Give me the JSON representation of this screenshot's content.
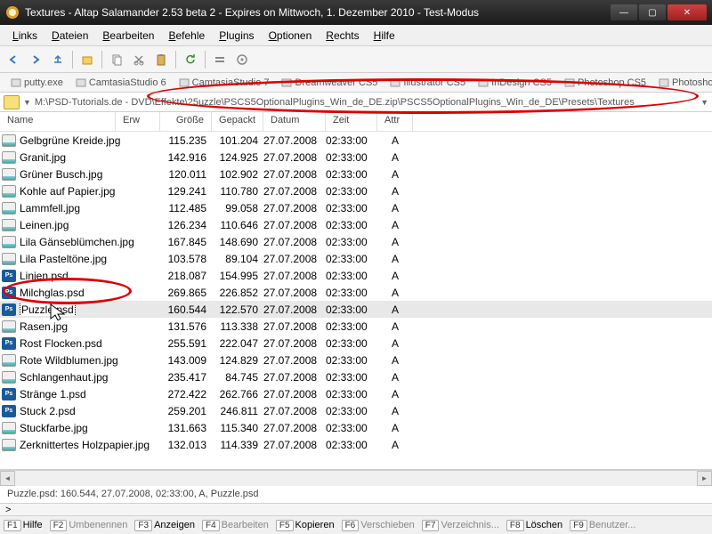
{
  "title": "Textures - Altap Salamander 2.53 beta 2 - Expires on Mittwoch, 1. Dezember 2010 - Test-Modus",
  "menu": [
    "Links",
    "Dateien",
    "Bearbeiten",
    "Befehle",
    "Plugins",
    "Optionen",
    "Rechts",
    "Hilfe"
  ],
  "tabs": [
    "putty.exe",
    "CamtasiaStudio 6",
    "CamtasiaStudio 7",
    "Dreamweaver CS5",
    "Illustrator CS5",
    "InDesign CS5",
    "Photoshop CS5",
    "Photoshop"
  ],
  "path_left": "M:\\PSD-Tutorials.de - DVD\\Effekte\\25",
  "path_right": "uzzle\\PSCS5OptionalPlugins_Win_de_DE.zip\\PSCS5OptionalPlugins_Win_de_DE\\Presets\\Textures",
  "cols": {
    "name": "Name",
    "erw": "Erw",
    "size": "Größe",
    "packed": "Gepackt",
    "date": "Datum",
    "time": "Zeit",
    "attr": "Attr"
  },
  "selected": "Puzzle.psd",
  "files": [
    {
      "n": "Gelbgrüne Kreide.jpg",
      "t": "jpg",
      "s": "115.235",
      "p": "101.204",
      "d": "27.07.2008",
      "tm": "02:33:00",
      "a": "A"
    },
    {
      "n": "Granit.jpg",
      "t": "jpg",
      "s": "142.916",
      "p": "124.925",
      "d": "27.07.2008",
      "tm": "02:33:00",
      "a": "A"
    },
    {
      "n": "Grüner Busch.jpg",
      "t": "jpg",
      "s": "120.011",
      "p": "102.902",
      "d": "27.07.2008",
      "tm": "02:33:00",
      "a": "A"
    },
    {
      "n": "Kohle auf Papier.jpg",
      "t": "jpg",
      "s": "129.241",
      "p": "110.780",
      "d": "27.07.2008",
      "tm": "02:33:00",
      "a": "A"
    },
    {
      "n": "Lammfell.jpg",
      "t": "jpg",
      "s": "112.485",
      "p": "99.058",
      "d": "27.07.2008",
      "tm": "02:33:00",
      "a": "A"
    },
    {
      "n": "Leinen.jpg",
      "t": "jpg",
      "s": "126.234",
      "p": "110.646",
      "d": "27.07.2008",
      "tm": "02:33:00",
      "a": "A"
    },
    {
      "n": "Lila Gänseblümchen.jpg",
      "t": "jpg",
      "s": "167.845",
      "p": "148.690",
      "d": "27.07.2008",
      "tm": "02:33:00",
      "a": "A"
    },
    {
      "n": "Lila Pasteltöne.jpg",
      "t": "jpg",
      "s": "103.578",
      "p": "89.104",
      "d": "27.07.2008",
      "tm": "02:33:00",
      "a": "A"
    },
    {
      "n": "Linien.psd",
      "t": "psd",
      "s": "218.087",
      "p": "154.995",
      "d": "27.07.2008",
      "tm": "02:33:00",
      "a": "A"
    },
    {
      "n": "Milchglas.psd",
      "t": "psd",
      "s": "269.865",
      "p": "226.852",
      "d": "27.07.2008",
      "tm": "02:33:00",
      "a": "A"
    },
    {
      "n": "Puzzle.psd",
      "t": "psd",
      "s": "160.544",
      "p": "122.570",
      "d": "27.07.2008",
      "tm": "02:33:00",
      "a": "A"
    },
    {
      "n": "Rasen.jpg",
      "t": "jpg",
      "s": "131.576",
      "p": "113.338",
      "d": "27.07.2008",
      "tm": "02:33:00",
      "a": "A"
    },
    {
      "n": "Rost Flocken.psd",
      "t": "psd",
      "s": "255.591",
      "p": "222.047",
      "d": "27.07.2008",
      "tm": "02:33:00",
      "a": "A"
    },
    {
      "n": "Rote Wildblumen.jpg",
      "t": "jpg",
      "s": "143.009",
      "p": "124.829",
      "d": "27.07.2008",
      "tm": "02:33:00",
      "a": "A"
    },
    {
      "n": "Schlangenhaut.jpg",
      "t": "jpg",
      "s": "235.417",
      "p": "84.745",
      "d": "27.07.2008",
      "tm": "02:33:00",
      "a": "A"
    },
    {
      "n": "Stränge 1.psd",
      "t": "psd",
      "s": "272.422",
      "p": "262.766",
      "d": "27.07.2008",
      "tm": "02:33:00",
      "a": "A"
    },
    {
      "n": "Stuck 2.psd",
      "t": "psd",
      "s": "259.201",
      "p": "246.811",
      "d": "27.07.2008",
      "tm": "02:33:00",
      "a": "A"
    },
    {
      "n": "Stuckfarbe.jpg",
      "t": "jpg",
      "s": "131.663",
      "p": "115.340",
      "d": "27.07.2008",
      "tm": "02:33:00",
      "a": "A"
    },
    {
      "n": "Zerknittertes Holzpapier.jpg",
      "t": "jpg",
      "s": "132.013",
      "p": "114.339",
      "d": "27.07.2008",
      "tm": "02:33:00",
      "a": "A"
    }
  ],
  "status": "Puzzle.psd: 160.544, 27.07.2008, 02:33:00, A, Puzzle.psd",
  "midbar": ">",
  "fn": [
    {
      "k": "F1",
      "l": "Hilfe",
      "a": true
    },
    {
      "k": "F2",
      "l": "Umbenennen",
      "a": false
    },
    {
      "k": "F3",
      "l": "Anzeigen",
      "a": true
    },
    {
      "k": "F4",
      "l": "Bearbeiten",
      "a": false
    },
    {
      "k": "F5",
      "l": "Kopieren",
      "a": true
    },
    {
      "k": "F6",
      "l": "Verschieben",
      "a": false
    },
    {
      "k": "F7",
      "l": "Verzeichnis...",
      "a": false
    },
    {
      "k": "F8",
      "l": "Löschen",
      "a": true
    },
    {
      "k": "F9",
      "l": "Benutzer...",
      "a": false
    }
  ]
}
